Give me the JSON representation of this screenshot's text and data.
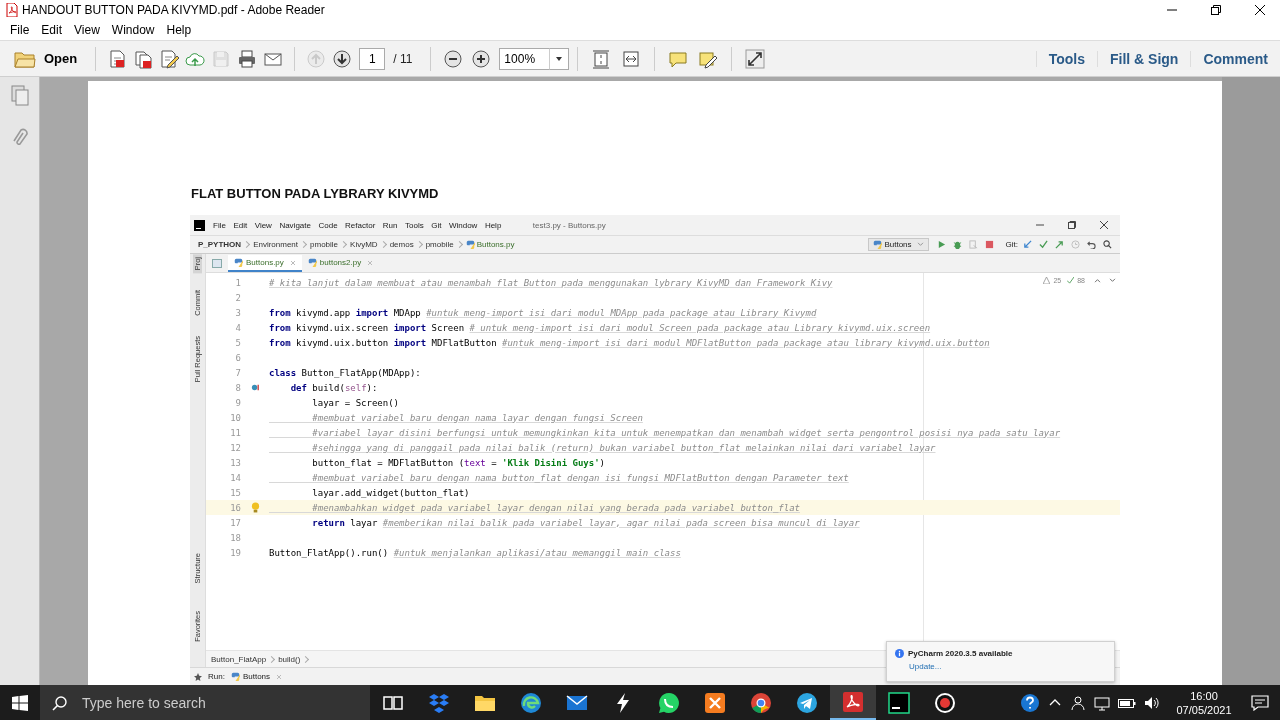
{
  "window": {
    "title": "HANDOUT BUTTON PADA KIVYMD.pdf - Adobe Reader"
  },
  "menu": [
    "File",
    "Edit",
    "View",
    "Window",
    "Help"
  ],
  "toolbar": {
    "open": "Open",
    "tools": [
      {
        "kind": "create",
        "disabled": false
      },
      {
        "kind": "combine",
        "disabled": false
      },
      {
        "kind": "edit",
        "disabled": false
      },
      {
        "kind": "upload",
        "disabled": false
      },
      {
        "kind": "save",
        "disabled": true
      },
      {
        "kind": "print",
        "disabled": false
      },
      {
        "kind": "mail",
        "disabled": false
      }
    ],
    "nav": [
      {
        "kind": "up",
        "disabled": true
      },
      {
        "kind": "down",
        "disabled": false
      }
    ],
    "page": "1",
    "page_count": "/ 11",
    "zoom": "100%",
    "panels": [
      "Tools",
      "Fill & Sign",
      "Comment"
    ]
  },
  "document": {
    "heading": "FLAT BUTTON PADA LYBRARY KIVYMD",
    "ide": {
      "menu": [
        "File",
        "Edit",
        "View",
        "Navigate",
        "Code",
        "Refactor",
        "Run",
        "Tools",
        "Git",
        "Window",
        "Help"
      ],
      "title": "test3.py - Buttons.py",
      "breadcrumbs": [
        "P_PYTHON",
        "Environment",
        "pmobile",
        "KivyMD",
        "demos",
        "pmobile",
        "Buttons.py"
      ],
      "run_config": "Buttons",
      "git_label": "Git:",
      "tabs": [
        {
          "label": "Buttons.py",
          "selected": true
        },
        {
          "label": "buttons2.py",
          "selected": false
        }
      ],
      "tool_tabs_top": [
        {
          "label": "Proj",
          "selected": true
        },
        {
          "label": "Commit",
          "selected": false
        },
        {
          "label": "Pull Requests",
          "selected": false
        }
      ],
      "tool_tabs_bottom": [
        {
          "label": "Structure",
          "selected": false
        },
        {
          "label": "Favorites",
          "selected": false
        }
      ],
      "warnings": "25",
      "checks": "88",
      "lines": [
        {
          "n": "1",
          "current": false,
          "tokens": [
            {
              "kind": "comment",
              "text": "# kita lanjut dalam membuat atau menambah flat Button pada menggunakan lybrary KivyMD dan Framework Kivy"
            }
          ]
        },
        {
          "n": "2",
          "current": false
        },
        {
          "n": "3",
          "current": false,
          "tokens": [
            {
              "kind": "kw",
              "text": "from"
            },
            {
              "kind": "plain",
              "text": " kivymd.app "
            },
            {
              "kind": "kw",
              "text": "import"
            },
            {
              "kind": "plain",
              "text": " MDApp "
            },
            {
              "kind": "comment",
              "text": "#untuk meng-import isi dari modul MDApp pada package atau Library Kivymd"
            }
          ]
        },
        {
          "n": "4",
          "current": false,
          "tokens": [
            {
              "kind": "kw",
              "text": "from"
            },
            {
              "kind": "plain",
              "text": " kivymd.uix.screen "
            },
            {
              "kind": "kw",
              "text": "import"
            },
            {
              "kind": "plain",
              "text": " Screen "
            },
            {
              "kind": "comment",
              "text": "# untuk meng-import isi dari modul Screen pada package atau Library kivymd.uix.screen"
            }
          ]
        },
        {
          "n": "5",
          "current": false,
          "tokens": [
            {
              "kind": "kw",
              "text": "from"
            },
            {
              "kind": "plain",
              "text": " kivymd.uix.button "
            },
            {
              "kind": "kw",
              "text": "import"
            },
            {
              "kind": "plain",
              "text": " MDFlatButton "
            },
            {
              "kind": "comment",
              "text": "#untuk meng-import isi dari modul MDFlatButton pada package atau library kivymd.uix.button"
            }
          ]
        },
        {
          "n": "6",
          "current": false
        },
        {
          "n": "7",
          "current": false,
          "tokens": [
            {
              "kind": "kw",
              "text": "class"
            },
            {
              "kind": "plain",
              "text": " Button_FlatApp(MDApp):"
            }
          ]
        },
        {
          "n": "8",
          "current": false,
          "gutter": {
            "kind": "override"
          },
          "tokens": [
            {
              "kind": "kw",
              "text": "    def"
            },
            {
              "kind": "plain",
              "text": " build("
            },
            {
              "kind": "self",
              "text": "self"
            },
            {
              "kind": "plain",
              "text": "):"
            }
          ]
        },
        {
          "n": "9",
          "current": false,
          "tokens": [
            {
              "kind": "plain",
              "text": "        layar = Screen()"
            }
          ]
        },
        {
          "n": "10",
          "current": false,
          "tokens": [
            {
              "kind": "comment",
              "text": "        #membuat variabel baru dengan nama layar dengan fungsi Screen"
            }
          ]
        },
        {
          "n": "11",
          "current": false,
          "tokens": [
            {
              "kind": "comment",
              "text": "        #variabel layar disini berfungsi untuk memungkinkan kita untuk menempatkan dan menambah widget serta pengontrol posisi nya pada satu layar"
            }
          ]
        },
        {
          "n": "12",
          "current": false,
          "tokens": [
            {
              "kind": "comment",
              "text": "        #sehingga yang di panggail pada nilai balik (return) bukan variabel button_flat melainkan nilai dari variabel layar"
            }
          ]
        },
        {
          "n": "13",
          "current": false,
          "tokens": [
            {
              "kind": "plain",
              "text": "        button_flat = MDFlatButton ("
            },
            {
              "kind": "kwarg",
              "text": "text"
            },
            {
              "kind": "plain",
              "text": " = "
            },
            {
              "kind": "str",
              "text": "'Klik Disini Guys'"
            },
            {
              "kind": "plain",
              "text": ")"
            }
          ]
        },
        {
          "n": "14",
          "current": false,
          "tokens": [
            {
              "kind": "comment",
              "text": "        #membuat variabel baru dengan nama button_flat dengan isi fungsi MDFlatButton dengan Parameter text"
            }
          ]
        },
        {
          "n": "15",
          "current": false,
          "tokens": [
            {
              "kind": "plain",
              "text": "        layar.add_widget(button_flat)"
            }
          ]
        },
        {
          "n": "16",
          "current": true,
          "gutter": {
            "kind": "bulb"
          },
          "tokens": [
            {
              "kind": "comment",
              "text": "        #menambahkan widget pada variabel layar dengan nilai yang berada pada variabel button_flat"
            }
          ]
        },
        {
          "n": "17",
          "current": false,
          "tokens": [
            {
              "kind": "kw",
              "text": "        return"
            },
            {
              "kind": "plain",
              "text": " layar "
            },
            {
              "kind": "comment",
              "text": "#memberikan nilai balik pada variabel layar, agar nilai pada screen bisa muncul di layar"
            }
          ]
        },
        {
          "n": "18",
          "current": false
        },
        {
          "n": "19",
          "current": false,
          "tokens": [
            {
              "kind": "plain",
              "text": "Button_FlatApp().run() "
            },
            {
              "kind": "comment",
              "text": "#untuk menjalankan aplikasi/atau memanggil main class"
            }
          ]
        }
      ],
      "crumbs": [
        "Button_FlatApp",
        "build()"
      ],
      "run": {
        "label": "Run:",
        "tab": "Buttons"
      },
      "notification": {
        "title": "PyCharm 2020.3.5 available",
        "link": "Update..."
      }
    }
  },
  "taskbar": {
    "search": {
      "placeholder": "Type here to search"
    },
    "apps": [
      {
        "kind": "panes",
        "active": false
      },
      {
        "kind": "boxes",
        "active": false
      },
      {
        "kind": "folder",
        "active": false
      },
      {
        "kind": "swirl",
        "active": false
      },
      {
        "kind": "mail",
        "active": false
      },
      {
        "kind": "bolt",
        "active": false
      },
      {
        "kind": "chat",
        "active": false
      },
      {
        "kind": "square",
        "active": false
      },
      {
        "kind": "ring",
        "active": false
      },
      {
        "kind": "plane",
        "active": false
      },
      {
        "kind": "pdf",
        "active": true
      },
      {
        "kind": "dark",
        "active": false
      },
      {
        "kind": "record",
        "active": false
      }
    ],
    "time": "16:00",
    "date": "07/05/2021"
  }
}
